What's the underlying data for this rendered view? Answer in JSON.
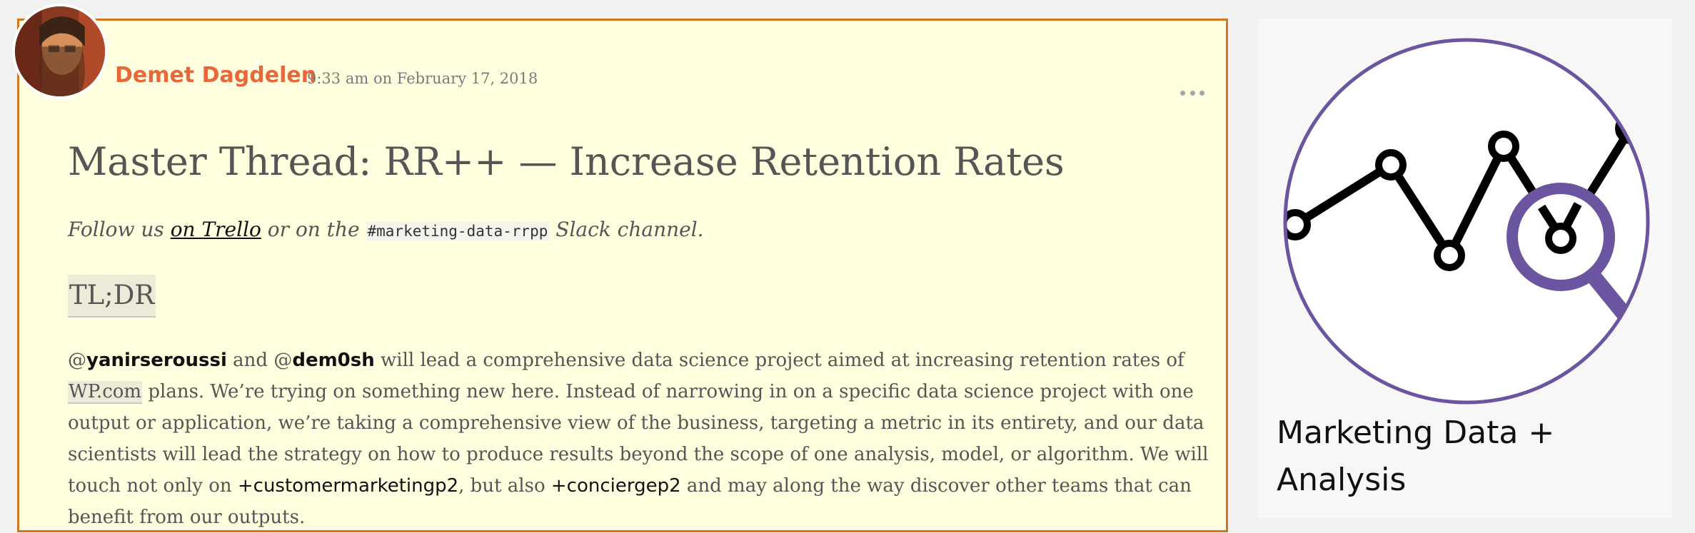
{
  "post": {
    "author": "Demet Dagdelen",
    "timestamp": "9:33 am on February 17, 2018",
    "title": "Master Thread: RR++ — Increase Retention Rates",
    "follow": {
      "prefix": "Follow us ",
      "trello_link": "on Trello",
      "middle": " or on the ",
      "channel": "#marketing-data-rrpp",
      "suffix": " Slack channel."
    },
    "tldr": "TL;DR",
    "body": {
      "at1": "@",
      "mention1": "yanirseroussi",
      "and": " and ",
      "at2": "@",
      "mention2": "dem0sh",
      "line1_rest": " will lead a comprehensive data science project aimed at increasing retention rates of",
      "wp_link": "WP.com",
      "line2_rest": " plans. We’re trying on something new here. Instead of narrowing in on a specific data science project with one",
      "line3": "output or application, we’re taking a comprehensive view of the business, targeting a metric in its entirety, and our data",
      "line4": "scientists will lead the strategy on how to produce results beyond the scope of one analysis, model, or algorithm. We will",
      "line5_start": "touch not only on ",
      "tag1": "+customermarketingp2",
      "line5_mid": ", but also ",
      "tag2": "+conciergep2",
      "line5_end": " and may along the way discover other teams that can",
      "line6": "benefit from our outputs."
    }
  },
  "sidebar": {
    "title": "Marketing Data + Analysis"
  },
  "colors": {
    "author": "#e8683a",
    "card_border": "#d07722",
    "card_bg": "#ffffe0",
    "logo_accent": "#6b55a0"
  },
  "icons": {
    "more": "ellipsis-icon",
    "logo": "chart-magnifier-logo"
  }
}
